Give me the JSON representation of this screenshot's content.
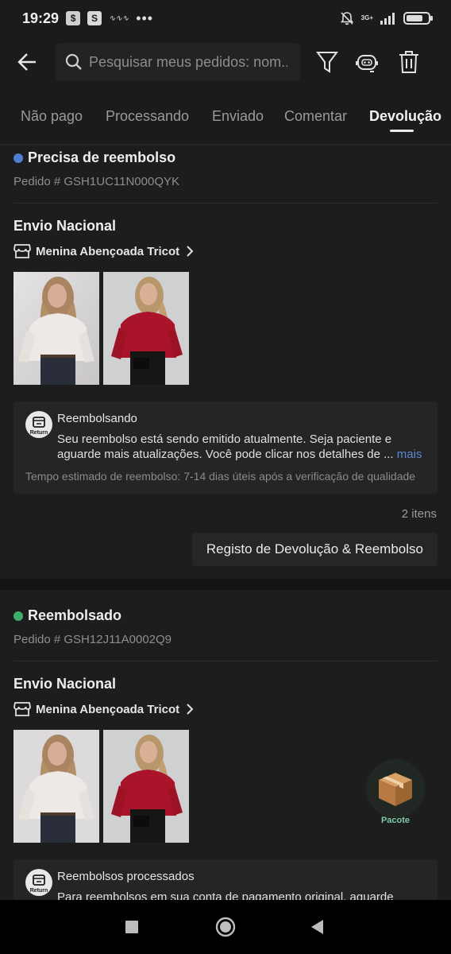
{
  "status_bar": {
    "time": "19:29",
    "network": "3G+"
  },
  "search": {
    "placeholder": "Pesquisar meus pedidos: nom..."
  },
  "tabs": [
    {
      "label": "Não pago",
      "active": false
    },
    {
      "label": "Processando",
      "active": false
    },
    {
      "label": "Enviado",
      "active": false
    },
    {
      "label": "Comentar",
      "active": false
    },
    {
      "label": "Devolução",
      "active": true
    }
  ],
  "orders": [
    {
      "status": "Precisa de reembolso",
      "status_color": "#4f7fd0",
      "order_number": "Pedido # GSH1UC11N000QYK",
      "shipping": "Envio Nacional",
      "store": "Menina Abençoada Tricot",
      "refund": {
        "badge_label": "Return",
        "title": "Reembolsando",
        "message": "Seu reembolso está sendo emitido atualmente. Seja paciente e aguarde mais atualizações. Você pode clicar nos detalhes de ...",
        "more": "mais",
        "estimate": "Tempo estimado de reembolso: 7-14 dias úteis após a verificação de qualidade"
      },
      "item_count": "2 itens",
      "record_button": "Registo de Devolução & Reembolso"
    },
    {
      "status": "Reembolsado",
      "status_color": "#3fae6a",
      "order_number": "Pedido # GSH12J11A0002Q9",
      "shipping": "Envio Nacional",
      "store": "Menina Abençoada Tricot",
      "refund": {
        "badge_label": "Return",
        "title": "Reembolsos processados",
        "message": "Para reembolsos em sua conta de pagamento original, aguarde"
      }
    }
  ],
  "package_fab": {
    "label": "Pacote"
  },
  "colors": {
    "background": "#1b1b1b",
    "accent_link": "#5d88d0",
    "package_label": "#7fc9a6"
  }
}
